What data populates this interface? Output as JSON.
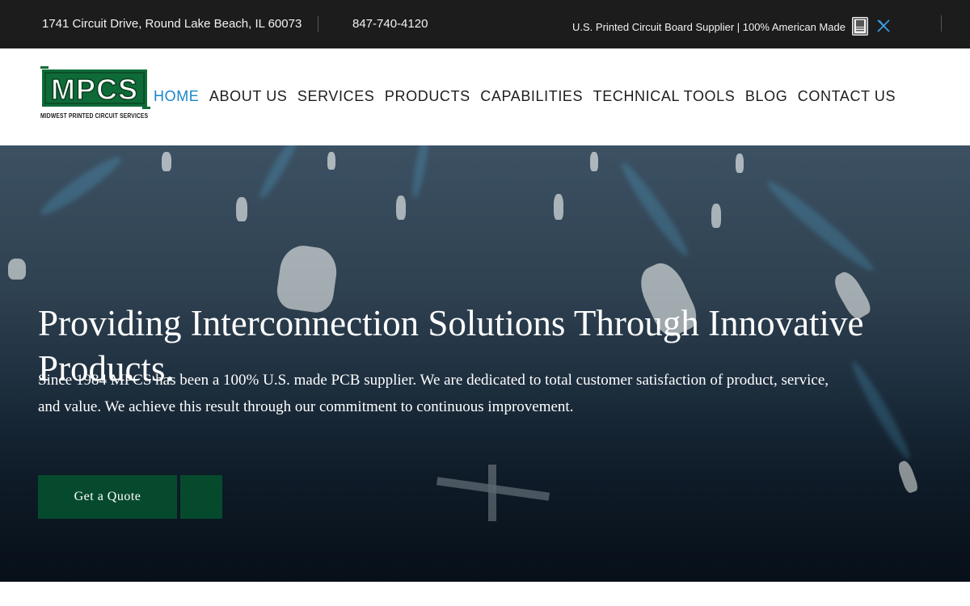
{
  "topbar": {
    "address": "1741 Circuit Drive, Round Lake Beach, IL 60073",
    "phone": "847-740-4120",
    "tagline": "U.S. Printed Circuit Board Supplier | 100% American Made",
    "badge_icon": "american-made-badge-icon",
    "social_icon": "x-twitter-icon"
  },
  "logo": {
    "letters": "MPCS",
    "subtitle": "MIDWEST PRINTED CIRCUIT SERVICES"
  },
  "nav": {
    "items": [
      {
        "label": "HOME",
        "active": true
      },
      {
        "label": "ABOUT US",
        "active": false
      },
      {
        "label": "SERVICES",
        "active": false
      },
      {
        "label": "PRODUCTS",
        "active": false
      },
      {
        "label": "CAPABILITIES",
        "active": false
      },
      {
        "label": "TECHNICAL TOOLS",
        "active": false
      },
      {
        "label": "BLOG",
        "active": false
      },
      {
        "label": "CONTACT US",
        "active": false
      }
    ]
  },
  "hero": {
    "heading": "Providing Interconnection Solutions Through Innovative Products.",
    "body": "Since 1984 MPCS has been a 100% U.S. made PCB supplier. We are dedicated to total customer satisfaction of product, service, and value. We achieve this result through our commitment to continuous improvement.",
    "cta_label": "Get a Quote"
  },
  "colors": {
    "topbar_bg": "#1c1c1c",
    "nav_active": "#1a85c8",
    "brand_green": "#064a2e",
    "logo_green": "#0e6b37"
  }
}
